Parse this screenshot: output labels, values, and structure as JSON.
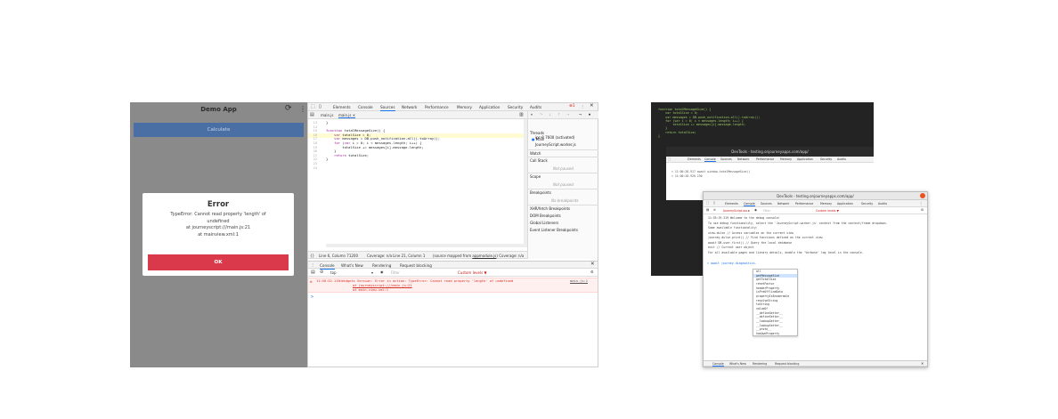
{
  "app": {
    "title": "Demo App",
    "refresh_icon": "refresh-icon",
    "menu_icon": "more-vert-icon",
    "calculate_label": "Calculate",
    "error": {
      "title": "Error",
      "message_lines": [
        "TypeError: Cannot read property 'length' of",
        "undefined",
        "at journeyscript:///main.js:21",
        "at mainview.xml:1"
      ],
      "ok_label": "OK"
    },
    "colors": {
      "accent": "#4a6fa5",
      "danger": "#d9394a"
    }
  },
  "devtools": {
    "tabs": [
      "Elements",
      "Console",
      "Sources",
      "Network",
      "Performance",
      "Memory",
      "Application",
      "Security",
      "Audits"
    ],
    "active_tab": "Sources",
    "error_count": "1",
    "files_tab": "main.js",
    "file_tab": "main.js",
    "code_lines": [
      {
        "n": "13",
        "t": "}"
      },
      {
        "n": "14",
        "t": ""
      },
      {
        "n": "15",
        "t": "function totalMessageSize() {"
      },
      {
        "n": "16",
        "t": "    var totalSize = 0;"
      },
      {
        "n": "17",
        "t": "    var messages = DB.push_notification.all().toArray();"
      },
      {
        "n": "18",
        "t": "    for (var i = 0; i < messages.length; i++) {"
      },
      {
        "n": "19",
        "t": "        totalSize += messages[i].message.length;"
      },
      {
        "n": "20",
        "t": "    }"
      },
      {
        "n": "21",
        "t": "    return totalSize;"
      },
      {
        "n": "22",
        "t": "}"
      },
      {
        "n": "23",
        "t": ""
      },
      {
        "n": "24",
        "t": ""
      }
    ],
    "status_bar": {
      "position": "Line 6, Column 71200",
      "coverage": "Coverage: n/a",
      "line2": "Line 21, Column 1",
      "mapped": "(source mapped from",
      "mapped_link": "appmodule.js",
      "mapped_end": ") Coverage: n/a"
    },
    "side": {
      "threads": "Threads",
      "main": "Main",
      "thread_items": [
        "ipc-8 7600 (activated)",
        "JourneyScript.worker.js"
      ],
      "watch": "Watch",
      "call_stack": "Call Stack",
      "not_paused": "Not paused",
      "scope": "Scope",
      "breakpoints": "Breakpoints",
      "no_breakpoints": "No breakpoints",
      "sections": [
        "XHR/fetch Breakpoints",
        "DOM Breakpoints",
        "Global Listeners",
        "Event Listener Breakpoints"
      ]
    },
    "drawer_tabs": [
      "Console",
      "What's New",
      "Rendering",
      "Request blocking"
    ],
    "console_context": "top",
    "filter_placeholder": "Filter",
    "levels": "Custom levels ▼",
    "console_error": {
      "time": "11:50:52.119",
      "text": "▸Widgets Version: Error in action: TypeError: Cannot read property 'length' of undefined",
      "stack1": "at journeyscript:///main.js:21",
      "stack2": "at main.view.xml:1",
      "source": "main.js:1"
    },
    "prompt": ">"
  },
  "right_shot": {
    "dark_code": [
      "function totalMessageSize() {",
      "    var totalSize = 0;",
      "    var messages = DB.push_notification.all().toArray();",
      "    for (var i = 0; i < messages.length; i++) {",
      "        totalSize += messages[i].message.length;",
      "    }",
      "",
      "    return totalSize;",
      "}"
    ],
    "inner_title": "DevTools - testing.onjourneyapps.com/app/",
    "inner_tabs": [
      "Elements",
      "Console",
      "Sources",
      "Network",
      "Performance",
      "Memory",
      "Application",
      "Security",
      "Audits"
    ],
    "inner_console": [
      "> 11:00:28.917  await window.totalMessageSize()",
      "< 11:00:28.920  230"
    ],
    "front_title": "DevTools - testing.onjourneyapps.com/app/",
    "front_tabs": [
      "Elements",
      "Console",
      "Sources",
      "Network",
      "Performance",
      "Memory",
      "Application",
      "Security",
      "Audits"
    ],
    "front_context": "JourneyScript.wo...",
    "front_filter": "Filter",
    "front_levels": "Custom levels ▼",
    "front_lines": [
      "11:55:19.319 Welcome to the debug console!",
      "To use debug functionality, select the 'JourneyScript.worker.js' context from the context/frame dropdown.",
      "Some available functionality:",
      "  view.dulse // Access variables on the current view",
      "  journey.dulse.print() // Find functions defined on the current view",
      "  await DB.user.first() // Query the local database",
      "  exit  // Current user object",
      "For all available pages and library details, enable the 'Verbose' log level in the console."
    ],
    "front_prompt": "> await journey.diagnostics.",
    "autocomplete": [
      "all",
      "getMessageSize",
      "getTotalSize",
      "resetFactor",
      "headerProperty",
      "isPreOfflineData",
      "propertyIsEnumerable",
      "resolveString",
      "toString",
      "valueOf",
      "__defineGetter__",
      "__defineSetter__",
      "__lookupGetter__",
      "__lookupSetter__",
      "__proto__",
      "hasOwnProperty"
    ],
    "front_drawer": [
      "Console",
      "What's New",
      "Rendering",
      "Request blocking"
    ]
  }
}
